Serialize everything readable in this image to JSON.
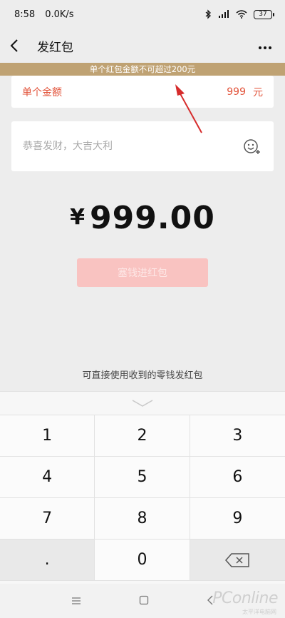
{
  "status": {
    "time": "8:58",
    "speed": "0.0K/s",
    "battery": "37"
  },
  "header": {
    "title": "发红包"
  },
  "warning": "单个红包金额不可超过200元",
  "amount_row": {
    "label": "单个金额",
    "value": "999",
    "unit": "元"
  },
  "wish": {
    "placeholder": "恭喜发财，大吉大利"
  },
  "total": {
    "currency": "¥",
    "amount": "999.00"
  },
  "send_button": "塞钱进红包",
  "hint": "可直接使用收到的零钱发红包",
  "keypad": {
    "keys": [
      "1",
      "2",
      "3",
      "4",
      "5",
      "6",
      "7",
      "8",
      "9",
      ".",
      "0"
    ]
  },
  "watermark": {
    "brand": "PConline",
    "sub": "太平洋电脑网"
  },
  "colors": {
    "accent": "#e2533a",
    "warning_bg": "#bfa273",
    "button_disabled": "#f9c3c1",
    "arrow": "#d62c2c"
  }
}
